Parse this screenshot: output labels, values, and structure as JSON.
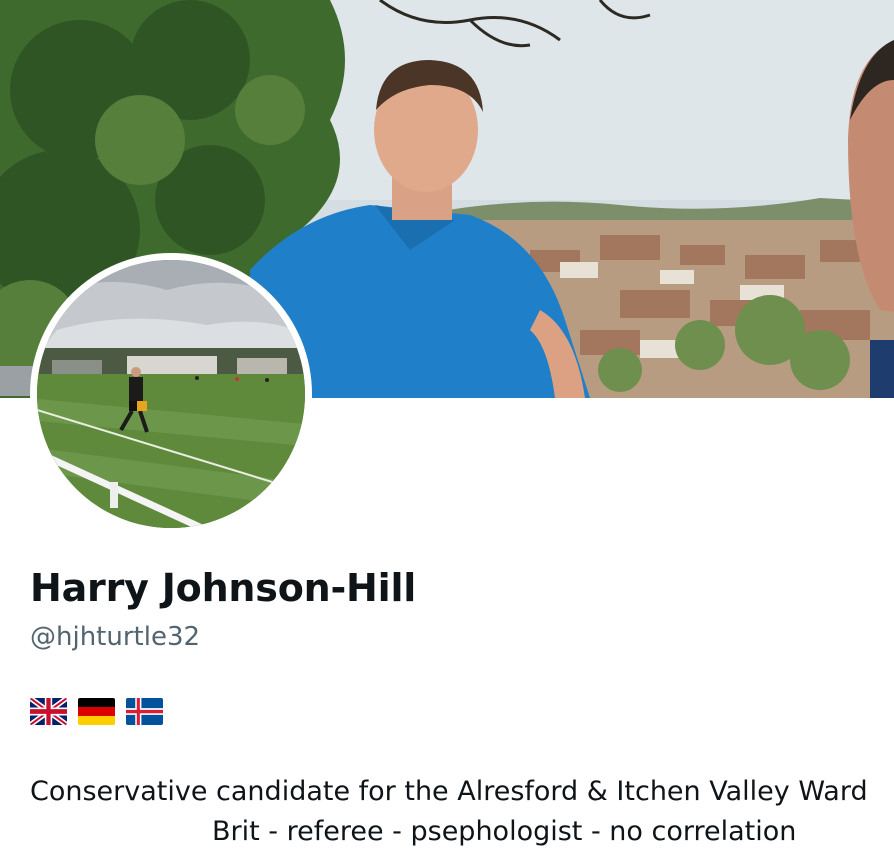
{
  "profile": {
    "display_name": "Harry Johnson-Hill",
    "handle": "@hjhturtle32",
    "flags": [
      "flag-uk",
      "flag-germany",
      "flag-iceland"
    ],
    "bio_line1": "Conservative candidate for the Alresford & Itchen Valley Ward",
    "bio_line2": "Brit - referee - psephologist - no correlation"
  },
  "colors": {
    "name_text": "#0f1419",
    "handle_text": "#536471",
    "background": "#ffffff"
  }
}
